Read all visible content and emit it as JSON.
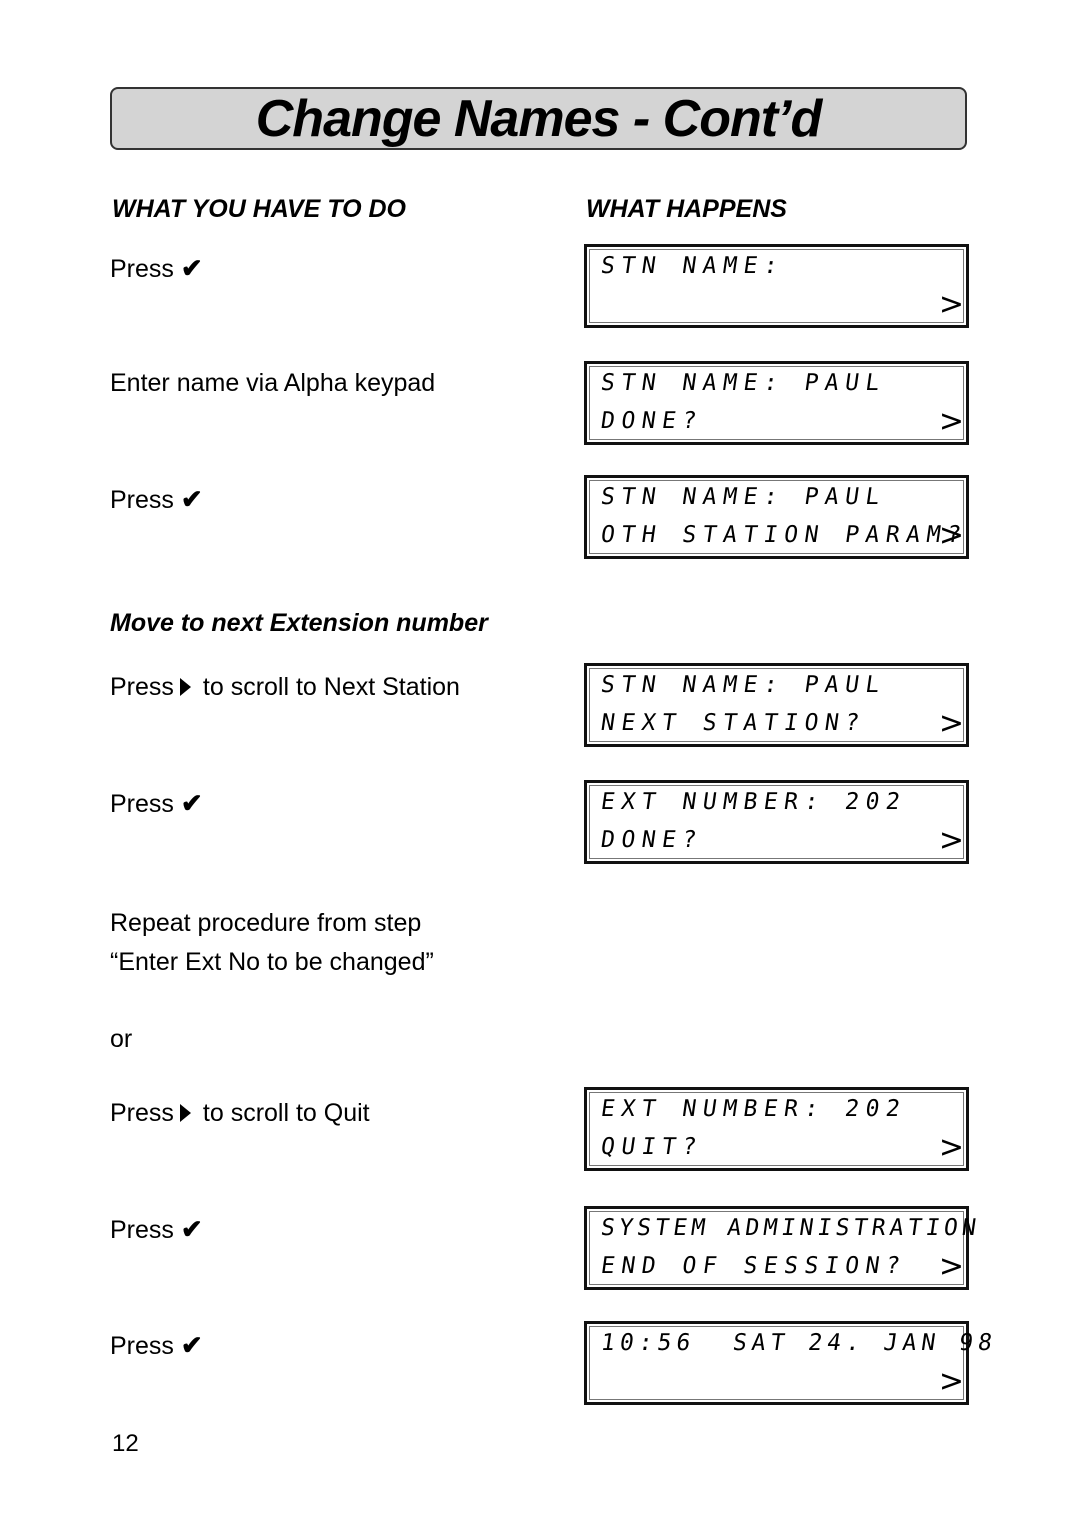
{
  "title": "Change Names - Cont’d",
  "columns": {
    "left_heading": "WHAT YOU HAVE TO DO",
    "right_heading": "WHAT HAPPENS"
  },
  "icons": {
    "check": "✔",
    "arrow_key": "right-triangle",
    "lcd_scroll": ">"
  },
  "steps": [
    {
      "text": "Press",
      "icon": "check"
    },
    {
      "text": "Enter name via Alpha keypad"
    },
    {
      "text": "Press",
      "icon": "check"
    },
    {
      "text_before": "Press",
      "icon": "arrow",
      "text_after": "to scroll to Next Station"
    },
    {
      "text": "Press",
      "icon": "check"
    },
    {
      "line1": "Repeat procedure from step",
      "line2": "“Enter Ext No to be changed”"
    },
    {
      "text": "or"
    },
    {
      "text_before": "Press",
      "icon": "arrow",
      "text_after": "to scroll to Quit"
    },
    {
      "text": "Press",
      "icon": "check"
    },
    {
      "text": "Press",
      "icon": "check"
    }
  ],
  "subheading": "Move to next Extension number",
  "displays": [
    {
      "line1": "STN NAME:",
      "line2": ""
    },
    {
      "line1": "STN NAME: PAUL",
      "line2": "DONE?"
    },
    {
      "line1": "STN NAME: PAUL",
      "line2": "OTH STATION PARAM?"
    },
    {
      "line1": "STN NAME: PAUL",
      "line2": "NEXT STATION?"
    },
    {
      "line1": "EXT NUMBER: 202",
      "line2": "DONE?"
    },
    {
      "line1": "EXT NUMBER: 202",
      "line2": "QUIT?"
    },
    {
      "line1": "SYSTEM ADMINISTRATION",
      "line2": "END OF SESSION?"
    },
    {
      "line1": "10:56  SAT 24. JAN 98",
      "line2": ""
    }
  ],
  "page_number": "12"
}
